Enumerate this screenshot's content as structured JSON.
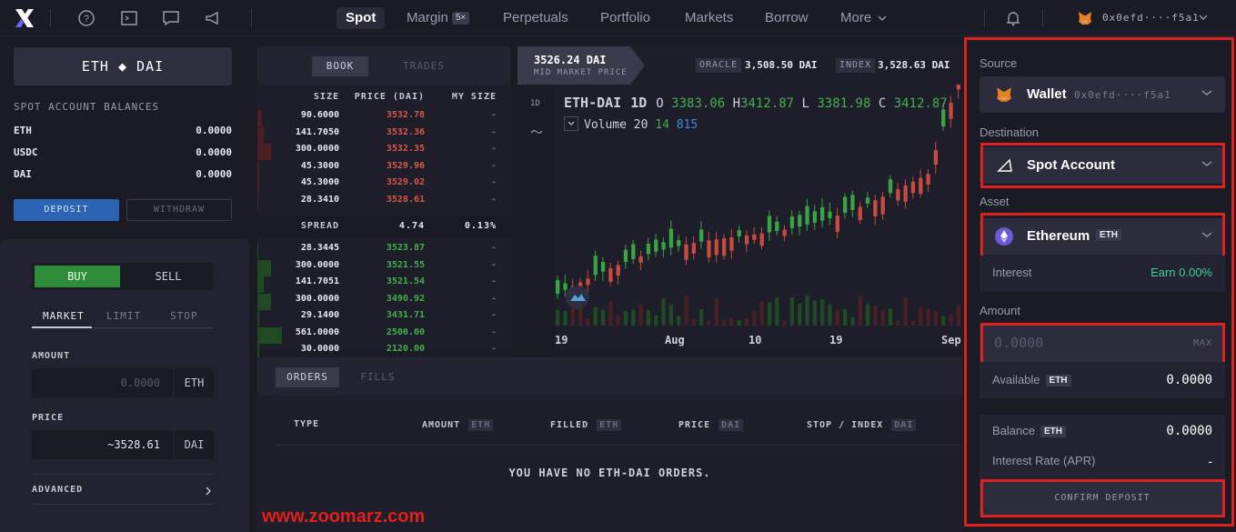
{
  "nav": {
    "tabs": [
      {
        "label": "Spot"
      },
      {
        "label": "Margin",
        "badge": "5×"
      },
      {
        "label": "Perpetuals"
      },
      {
        "label": "Portfolio"
      },
      {
        "label": "Markets"
      },
      {
        "label": "Borrow"
      },
      {
        "label": "More"
      }
    ],
    "wallet_address": "0x0efd····f5a1",
    "icons": [
      "help-icon",
      "terminal-icon",
      "chat-icon",
      "megaphone-icon",
      "bell-icon",
      "metamask-fox-icon"
    ]
  },
  "left": {
    "pair": "ETH ◆ DAI",
    "balances_title": "SPOT ACCOUNT BALANCES",
    "balances": [
      {
        "asset": "ETH",
        "value": "0.0000"
      },
      {
        "asset": "USDC",
        "value": "0.0000"
      },
      {
        "asset": "DAI",
        "value": "0.0000"
      }
    ],
    "deposit_label": "DEPOSIT",
    "withdraw_label": "WITHDRAW",
    "buy_label": "BUY",
    "sell_label": "SELL",
    "order_types": [
      "MARKET",
      "LIMIT",
      "STOP"
    ],
    "amount_label": "AMOUNT",
    "amount_placeholder": "0.0000",
    "amount_unit": "ETH",
    "price_label": "PRICE",
    "price_value": "~3528.61",
    "price_unit": "DAI",
    "advanced_label": "ADVANCED"
  },
  "book": {
    "tabs": [
      "BOOK",
      "TRADES"
    ],
    "headers": [
      "SIZE",
      "PRICE (DAI)",
      "MY SIZE"
    ],
    "asks": [
      {
        "size": "90.6000",
        "price": "3532.78",
        "my": "-",
        "depth": 0.15
      },
      {
        "size": "141.7050",
        "price": "3532.36",
        "my": "-",
        "depth": 0.22
      },
      {
        "size": "300.0000",
        "price": "3532.35",
        "my": "-",
        "depth": 0.5
      },
      {
        "size": "45.3000",
        "price": "3529.96",
        "my": "-",
        "depth": 0.07
      },
      {
        "size": "45.3000",
        "price": "3529.02",
        "my": "-",
        "depth": 0.07
      },
      {
        "size": "28.3410",
        "price": "3528.61",
        "my": "-",
        "depth": 0.04
      }
    ],
    "spread": {
      "label": "SPREAD",
      "value": "4.74",
      "pct": "0.13%"
    },
    "bids": [
      {
        "size": "28.3445",
        "price": "3523.87",
        "my": "-",
        "depth": 0.04
      },
      {
        "size": "300.0000",
        "price": "3521.55",
        "my": "-",
        "depth": 0.5
      },
      {
        "size": "141.7051",
        "price": "3521.54",
        "my": "-",
        "depth": 0.22
      },
      {
        "size": "300.0000",
        "price": "3490.92",
        "my": "-",
        "depth": 0.5
      },
      {
        "size": "29.1400",
        "price": "3431.71",
        "my": "-",
        "depth": 0.05
      },
      {
        "size": "561.0000",
        "price": "2500.00",
        "my": "-",
        "depth": 0.9
      },
      {
        "size": "30.0000",
        "price": "2120.00",
        "my": "-",
        "depth": 0.05
      }
    ]
  },
  "chart": {
    "mid_price": "3526.24 DAI",
    "mid_label": "MID MARKET PRICE",
    "oracle_label": "ORACLE",
    "oracle_value": "3,508.50 DAI",
    "index_label": "INDEX",
    "index_value": "3,528.63 DAI",
    "interval_button": "1D",
    "symbol": "ETH-DAI",
    "interval": "1D",
    "o_label": "O",
    "open": "3383.06",
    "h_label": "H",
    "high": "3412.87",
    "l_label": "L",
    "low": "3381.98",
    "c_label": "C",
    "close": "3412.87",
    "volume_label": "Volume 20",
    "volume_a": "14",
    "volume_b": "815",
    "x_ticks": [
      "19",
      "Aug",
      "10",
      "19",
      "Sep"
    ]
  },
  "orders": {
    "tabs": [
      "ORDERS",
      "FILLS"
    ],
    "columns": [
      {
        "label": "TYPE",
        "unit": ""
      },
      {
        "label": "AMOUNT",
        "unit": "ETH"
      },
      {
        "label": "FILLED",
        "unit": "ETH"
      },
      {
        "label": "PRICE",
        "unit": "DAI"
      },
      {
        "label": "STOP / INDEX",
        "unit": "DAI"
      }
    ],
    "empty_message": "YOU HAVE NO ETH-DAI ORDERS.",
    "watermark": "www.zoomarz.com"
  },
  "transfer": {
    "source_label": "Source",
    "source_value": "Wallet",
    "source_address": "0x0efd····f5a1",
    "destination_label": "Destination",
    "destination_value": "Spot Account",
    "asset_label": "Asset",
    "asset_value": "Ethereum",
    "asset_ticker": "ETH",
    "interest_label": "Interest",
    "interest_value": "Earn 0.00%",
    "amount_label": "Amount",
    "amount_placeholder": "0.0000",
    "max_label": "MAX",
    "available_label": "Available",
    "available_unit": "ETH",
    "available_value": "0.0000",
    "balance_label": "Balance",
    "balance_unit": "ETH",
    "balance_value": "0.0000",
    "rate_label": "Interest Rate (APR)",
    "rate_value": "-",
    "confirm_label": "CONFIRM DEPOSIT"
  },
  "colors": {
    "up": "#43b04c",
    "down": "#d9574a",
    "highlight": "#e0201c",
    "accent": "#2b64b5"
  }
}
